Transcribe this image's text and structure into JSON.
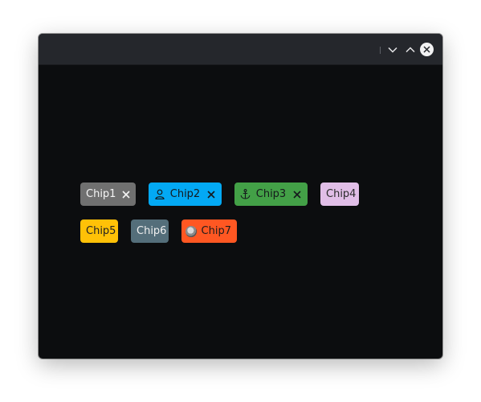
{
  "window": {
    "controls": {
      "minimize_icon": "chevron-down-icon",
      "maximize_icon": "chevron-up-icon",
      "close_icon": "close-icon"
    }
  },
  "chips": [
    {
      "label": "Chip1",
      "bg": "#707070",
      "fg": "#f5f5f5",
      "lead_icon": null,
      "deletable": true
    },
    {
      "label": "Chip2",
      "bg": "#03a9f4",
      "fg": "#15191c",
      "lead_icon": "person-icon",
      "deletable": true
    },
    {
      "label": "Chip3",
      "bg": "#43a047",
      "fg": "#15191c",
      "lead_icon": "anchor-icon",
      "deletable": true
    },
    {
      "label": "Chip4",
      "bg": "#e1bee7",
      "fg": "#2a2a2a",
      "lead_icon": null,
      "deletable": false
    },
    {
      "label": "Chip5",
      "bg": "#ffc107",
      "fg": "#222222",
      "lead_icon": null,
      "deletable": false
    },
    {
      "label": "Chip6",
      "bg": "#546e7a",
      "fg": "#f0f0f0",
      "lead_icon": null,
      "deletable": false
    },
    {
      "label": "Chip7",
      "bg": "#ff5722",
      "fg": "#1c1c1c",
      "lead_icon": "avatar-icon",
      "deletable": false
    }
  ]
}
